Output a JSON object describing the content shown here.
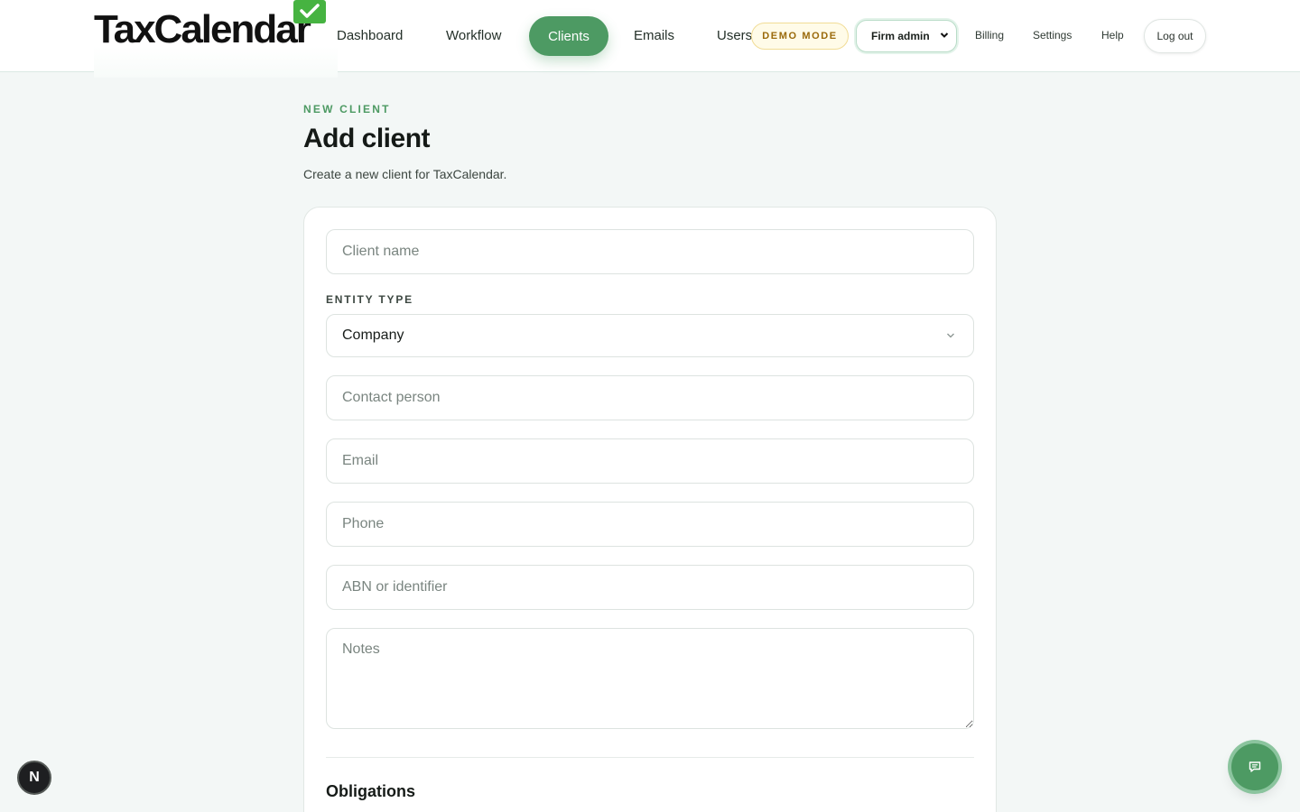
{
  "brand": {
    "name": "TaxCalendar",
    "accent": "#4d9a63",
    "logo_check_color": "#46b341"
  },
  "nav": {
    "items": [
      {
        "label": "Dashboard"
      },
      {
        "label": "Workflow"
      },
      {
        "label": "Clients",
        "active": true
      },
      {
        "label": "Emails"
      },
      {
        "label": "Users"
      }
    ],
    "demo_badge": "DEMO MODE",
    "role_select": {
      "selected": "Firm admin"
    },
    "links": [
      "Billing",
      "Settings",
      "Help"
    ],
    "logout": "Log out"
  },
  "page": {
    "eyebrow": "NEW CLIENT",
    "title": "Add client",
    "subtitle": "Create a new client for TaxCalendar."
  },
  "form": {
    "client_name": {
      "placeholder": "Client name",
      "value": ""
    },
    "entity_type": {
      "label": "ENTITY TYPE",
      "selected": "Company"
    },
    "contact_person": {
      "placeholder": "Contact person",
      "value": ""
    },
    "email": {
      "placeholder": "Email",
      "value": ""
    },
    "phone": {
      "placeholder": "Phone",
      "value": ""
    },
    "abn": {
      "placeholder": "ABN or identifier",
      "value": ""
    },
    "notes": {
      "placeholder": "Notes",
      "value": ""
    },
    "obligations_title": "Obligations"
  },
  "floating": {
    "dev_badge": "N",
    "chat_icon": "chat-bubble-icon"
  }
}
